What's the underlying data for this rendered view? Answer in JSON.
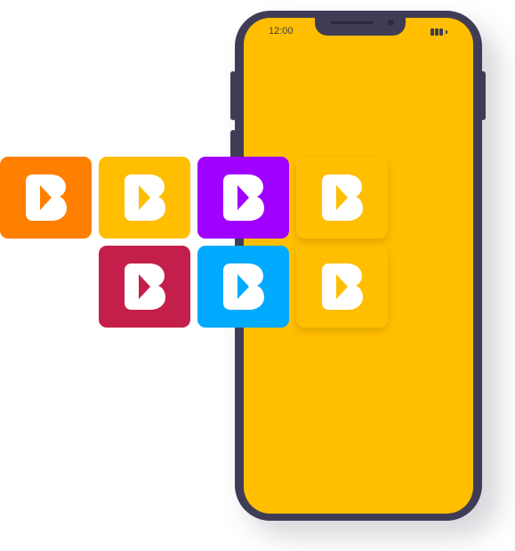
{
  "status_bar": {
    "time": "12:00",
    "battery_icon": "battery-icon"
  },
  "phone": {
    "frame_color": "#3f3d56",
    "screen_color": "#ffbe00"
  },
  "logo_icon": "b-logo-icon",
  "tiles": [
    {
      "name": "orange",
      "color": "#ff8000",
      "row": 1,
      "col": 1
    },
    {
      "name": "yellow",
      "color": "#ffbe00",
      "row": 1,
      "col": 2
    },
    {
      "name": "purple",
      "color": "#a000ff",
      "row": 1,
      "col": 3
    },
    {
      "name": "yellow-on-screen",
      "color": "#ffbe00",
      "row": 1,
      "col": 4
    },
    {
      "name": "crimson",
      "color": "#c41f4a",
      "row": 2,
      "col": 2
    },
    {
      "name": "blue",
      "color": "#00aaff",
      "row": 2,
      "col": 3
    },
    {
      "name": "yellow-on-screen",
      "color": "#ffbe00",
      "row": 2,
      "col": 4
    }
  ]
}
